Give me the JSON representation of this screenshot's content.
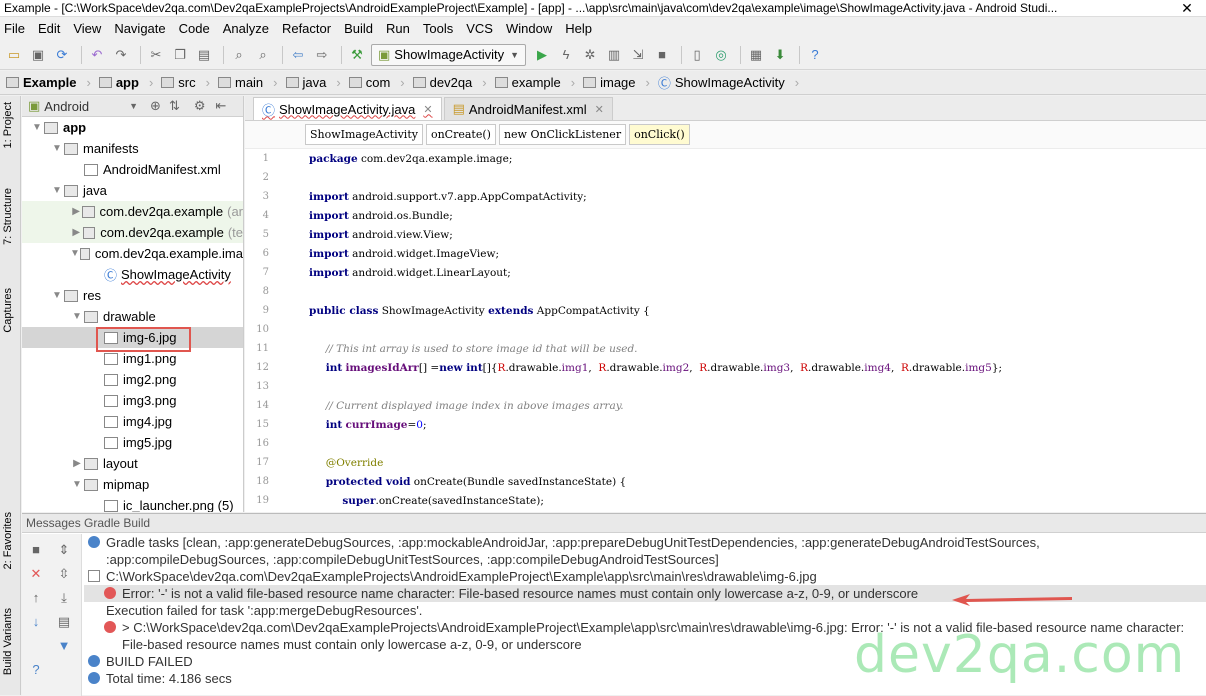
{
  "window": {
    "title": "Example - [C:\\WorkSpace\\dev2qa.com\\Dev2qaExampleProjects\\AndroidExampleProject\\Example] - [app] - ...\\app\\src\\main\\java\\com\\dev2qa\\example\\image\\ShowImageActivity.java - Android Studi..."
  },
  "menu": [
    "File",
    "Edit",
    "View",
    "Navigate",
    "Code",
    "Analyze",
    "Refactor",
    "Build",
    "Run",
    "Tools",
    "VCS",
    "Window",
    "Help"
  ],
  "toolbar": {
    "run_config": "ShowImageActivity"
  },
  "breadcrumb": [
    "Example",
    "app",
    "src",
    "main",
    "java",
    "com",
    "dev2qa",
    "example",
    "image",
    "ShowImageActivity"
  ],
  "left_tabs": {
    "project": "1: Project",
    "structure": "7: Structure",
    "captures": "Captures",
    "favorites": "2: Favorites",
    "build_variants": "Build Variants"
  },
  "project": {
    "view": "Android",
    "tree": [
      {
        "label": "app",
        "depth": 0,
        "type": "module",
        "bold": true
      },
      {
        "label": "manifests",
        "depth": 1,
        "type": "folder"
      },
      {
        "label": "AndroidManifest.xml",
        "depth": 2,
        "type": "file"
      },
      {
        "label": "java",
        "depth": 1,
        "type": "folder"
      },
      {
        "label": "com.dev2qa.example",
        "suffix": "(ar",
        "depth": 2,
        "type": "package",
        "green": true
      },
      {
        "label": "com.dev2qa.example",
        "suffix": "(te",
        "depth": 2,
        "type": "package",
        "green": true
      },
      {
        "label": "com.dev2qa.example.ima",
        "depth": 2,
        "type": "package"
      },
      {
        "label": "ShowImageActivity",
        "depth": 3,
        "type": "class"
      },
      {
        "label": "res",
        "depth": 1,
        "type": "folder"
      },
      {
        "label": "drawable",
        "depth": 2,
        "type": "folder"
      },
      {
        "label": "img-6.jpg",
        "depth": 3,
        "type": "file",
        "selected": true
      },
      {
        "label": "img1.png",
        "depth": 3,
        "type": "file"
      },
      {
        "label": "img2.png",
        "depth": 3,
        "type": "file"
      },
      {
        "label": "img3.png",
        "depth": 3,
        "type": "file"
      },
      {
        "label": "img4.jpg",
        "depth": 3,
        "type": "file"
      },
      {
        "label": "img5.jpg",
        "depth": 3,
        "type": "file"
      },
      {
        "label": "layout",
        "depth": 2,
        "type": "folder"
      },
      {
        "label": "mipmap",
        "depth": 2,
        "type": "folder"
      },
      {
        "label": "ic_launcher.png (5)",
        "depth": 3,
        "type": "file"
      }
    ]
  },
  "editor": {
    "tabs": [
      {
        "label": "ShowImageActivity.java"
      },
      {
        "label": "AndroidManifest.xml"
      }
    ],
    "method_bar": [
      "ShowImageActivity",
      "onCreate()",
      "new OnClickListener",
      "onClick()"
    ],
    "lines": [
      "1",
      "2",
      "3",
      "4",
      "5",
      "6",
      "7",
      "8",
      "9",
      "10",
      "11",
      "12",
      "13",
      "14",
      "15",
      "16",
      "17",
      "18",
      "19"
    ]
  },
  "messages": {
    "header": "Messages Gradle Build",
    "rows": [
      {
        "icon": "info",
        "text": "Gradle tasks [clean, :app:generateDebugSources, :app:mockableAndroidJar, :app:prepareDebugUnitTestDependencies, :app:generateDebugAndroidTestSources, :app:compileDebugSources, :app:compileDebugUnitTestSources, :app:compileDebugAndroidTestSources]"
      },
      {
        "icon": "file",
        "text": "C:\\WorkSpace\\dev2qa.com\\Dev2qaExampleProjects\\AndroidExampleProject\\Example\\app\\src\\main\\res\\drawable\\img-6.jpg"
      },
      {
        "icon": "error",
        "text": "Error: '-' is not a valid file-based resource name character: File-based resource names must contain only lowercase a-z, 0-9, or underscore",
        "highlight": true
      },
      {
        "icon": "none",
        "text": "Execution failed for task ':app:mergeDebugResources'."
      },
      {
        "icon": "error",
        "text": "> C:\\WorkSpace\\dev2qa.com\\Dev2qaExampleProjects\\AndroidExampleProject\\Example\\app\\src\\main\\res\\drawable\\img-6.jpg: Error: '-' is not a valid file-based resource name character: File-based resource names must contain only lowercase a-z, 0-9, or underscore"
      },
      {
        "icon": "info",
        "text": "BUILD FAILED"
      },
      {
        "icon": "info",
        "text": "Total time: 4.186 secs"
      }
    ]
  },
  "watermark": "dev2qa.com",
  "colors": {
    "highlight_box": "#e0564f",
    "keyword": "#000080",
    "comment": "#808080",
    "field": "#660e7a",
    "watermark": "#a3e7b0"
  }
}
